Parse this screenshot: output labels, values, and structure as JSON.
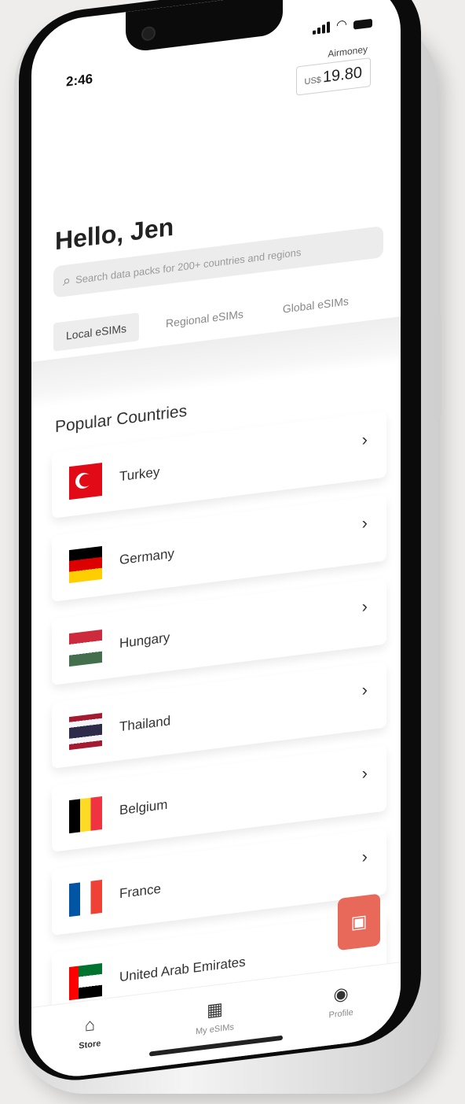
{
  "status": {
    "time": "2:46"
  },
  "wallet": {
    "brand": "Airmoney",
    "currency": "US$",
    "balance": "19.80"
  },
  "greeting": "Hello, Jen",
  "search": {
    "placeholder": "Search data packs for 200+ countries and regions"
  },
  "tabs": [
    {
      "label": "Local eSIMs",
      "active": true
    },
    {
      "label": "Regional eSIMs",
      "active": false
    },
    {
      "label": "Global eSIMs",
      "active": false
    }
  ],
  "section_title": "Popular Countries",
  "countries": [
    {
      "name": "Turkey",
      "flag": "turkey-flag"
    },
    {
      "name": "Germany",
      "flag": "germany-flag"
    },
    {
      "name": "Hungary",
      "flag": "hungary-flag"
    },
    {
      "name": "Thailand",
      "flag": "thailand-flag"
    },
    {
      "name": "Belgium",
      "flag": "belgium-flag"
    },
    {
      "name": "France",
      "flag": "france-flag"
    },
    {
      "name": "United Arab Emirates",
      "flag": "uae-flag"
    }
  ],
  "bottom_nav": [
    {
      "label": "Store",
      "icon": "store-icon",
      "active": true
    },
    {
      "label": "My eSIMs",
      "icon": "sim-icon",
      "active": false
    },
    {
      "label": "Profile",
      "icon": "profile-icon",
      "active": false
    }
  ],
  "colors": {
    "accent": "#e8685a",
    "frame": "#0b0b0b"
  }
}
